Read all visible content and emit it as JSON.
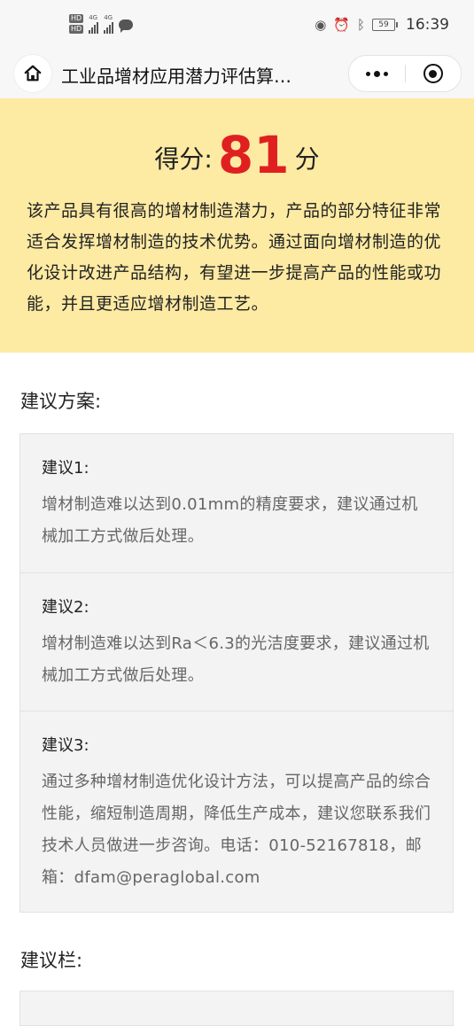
{
  "status_bar": {
    "hd_top": "HD",
    "hd_bottom": "HD",
    "net1": "4G",
    "net2": "4G",
    "battery": "59",
    "time": "16:39"
  },
  "nav": {
    "title": "工业品增材应用潜力评估算…"
  },
  "score": {
    "prefix": "得分:",
    "value": "81",
    "suffix": "分",
    "description": "该产品具有很高的增材制造潜力，产品的部分特征非常适合发挥增材制造的技术优势。通过面向增材制造的优化设计改进产品结构，有望进一步提高产品的性能或功能，并且更适应增材制造工艺。"
  },
  "suggestions": {
    "section_title": "建议方案:",
    "items": [
      {
        "title": "建议1:",
        "body": "增材制造难以达到0.01mm的精度要求，建议通过机械加工方式做后处理。"
      },
      {
        "title": "建议2:",
        "body": "增材制造难以达到Ra＜6.3的光洁度要求，建议通过机械加工方式做后处理。"
      },
      {
        "title": "建议3:",
        "body": "通过多种增材制造优化设计方法，可以提高产品的综合性能，缩短制造周期，降低生产成本，建议您联系我们技术人员做进一步咨询。电话：010-52167818，邮箱：dfam@peraglobal.com"
      }
    ]
  },
  "advice_bar": {
    "section_title": "建议栏:"
  }
}
